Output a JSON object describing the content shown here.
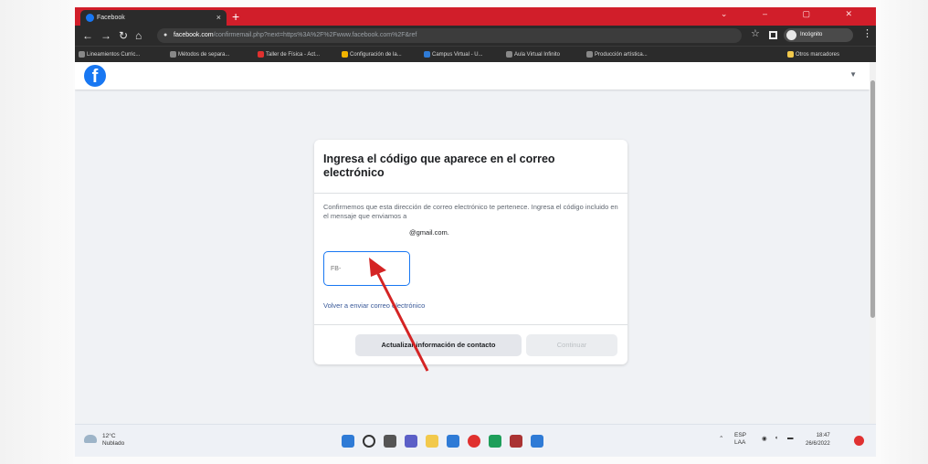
{
  "browser": {
    "tab_title": "Facebook",
    "tab_close": "×",
    "new_tab": "+",
    "window_controls": "⌄ – ▢ ✕",
    "nav": {
      "back": "←",
      "forward": "→",
      "reload": "↻",
      "home": "⌂"
    },
    "url_host": "facebook.com",
    "url_path": "/confirmemail.php?next=https%3A%2F%2Fwww.facebook.com%2F&ref",
    "profile_label": "Incógnito",
    "bookmarks": [
      {
        "label": "Lineamientos Curric...",
        "color": "#888888"
      },
      {
        "label": "Métodos de separa...",
        "color": "#888888"
      },
      {
        "label": "Taller de Física - Act...",
        "color": "#e0312f"
      },
      {
        "label": "Configuración de la...",
        "color": "#f2b400"
      },
      {
        "label": "Campus Virtual - U...",
        "color": "#2f7bd6"
      },
      {
        "label": "Aula Virtual Infinito",
        "color": "#888888"
      },
      {
        "label": "Producción artística...",
        "color": "#888888"
      }
    ],
    "other_bookmarks": "Otros marcadores"
  },
  "page": {
    "logo_letter": "f",
    "card": {
      "title": "Ingresa el código que aparece en el correo electrónico",
      "description": "Confirmemos que esta dirección de correo electrónico te pertenece. Ingresa el código incluido en el mensaje que enviamos a",
      "email": "@gmail.com.",
      "code_placeholder": "FB-",
      "resend_link": "Volver a enviar correo electrónico",
      "update_button": "Actualizar información de contacto",
      "continue_button": "Continuar"
    }
  },
  "taskbar": {
    "temperature": "12°C",
    "weather": "Nublado",
    "language": "ESP\nLAA",
    "time": "18:47",
    "date": "26/6/2022"
  }
}
